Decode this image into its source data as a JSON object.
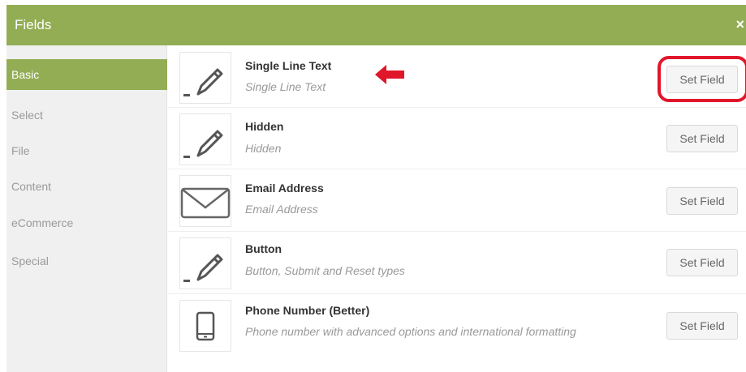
{
  "header": {
    "title": "Fields",
    "close_label": "×"
  },
  "sidebar": {
    "items": [
      {
        "label": "Basic",
        "active": true
      },
      {
        "label": "Select",
        "active": false
      },
      {
        "label": "File",
        "active": false
      },
      {
        "label": "Content",
        "active": false
      },
      {
        "label": "eCommerce",
        "active": false
      },
      {
        "label": "Special",
        "active": false
      }
    ]
  },
  "fields": [
    {
      "title": "Single Line Text",
      "description": "Single Line Text",
      "icon": "pencil-icon",
      "button_label": "Set Field"
    },
    {
      "title": "Hidden",
      "description": "Hidden",
      "icon": "pencil-icon",
      "button_label": "Set Field"
    },
    {
      "title": "Email Address",
      "description": "Email Address",
      "icon": "envelope-icon",
      "button_label": "Set Field"
    },
    {
      "title": "Button",
      "description": "Button, Submit and Reset types",
      "icon": "pencil-icon",
      "button_label": "Set Field"
    },
    {
      "title": "Phone Number (Better)",
      "description": "Phone number with advanced options and international formatting",
      "icon": "phone-icon",
      "button_label": "Set Field"
    }
  ],
  "colors": {
    "accent": "#93ad55",
    "annotation": "#e0162b"
  }
}
